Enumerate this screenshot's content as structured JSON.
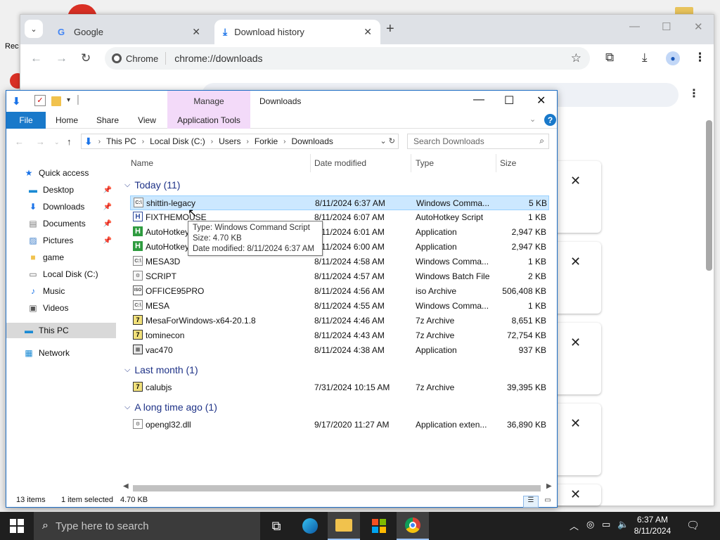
{
  "desktop": {
    "recycle_label": "Rec"
  },
  "chrome": {
    "tabs": [
      {
        "title": "Google",
        "close": "✕"
      },
      {
        "title": "Download history",
        "close": "✕"
      }
    ],
    "new_tab": "+",
    "omnibox_chip": "Chrome",
    "url": "chrome://downloads",
    "window_buttons": {
      "minimize": "—",
      "maximize": "☐",
      "close": "✕"
    },
    "download_card_close": "✕"
  },
  "explorer": {
    "title": "Downloads",
    "manage_label": "Manage",
    "ribbon_tabs": [
      "File",
      "Home",
      "Share",
      "View",
      "Application Tools"
    ],
    "breadcrumb": [
      "This PC",
      "Local Disk (C:)",
      "Users",
      "Forkie",
      "Downloads"
    ],
    "search_placeholder": "Search Downloads",
    "nav": [
      {
        "label": "Quick access",
        "icon": "star-icon"
      },
      {
        "label": "Desktop",
        "icon": "desktop-icon"
      },
      {
        "label": "Downloads",
        "icon": "downloads-icon"
      },
      {
        "label": "Documents",
        "icon": "documents-icon"
      },
      {
        "label": "Pictures",
        "icon": "pictures-icon"
      },
      {
        "label": "game",
        "icon": "folder-icon"
      },
      {
        "label": "Local Disk (C:)",
        "icon": "drive-icon"
      },
      {
        "label": "Music",
        "icon": "music-icon"
      },
      {
        "label": "Videos",
        "icon": "videos-icon"
      },
      {
        "label": "This PC",
        "icon": "pc-icon"
      },
      {
        "label": "Network",
        "icon": "network-icon"
      }
    ],
    "columns": {
      "name": "Name",
      "date": "Date modified",
      "type": "Type",
      "size": "Size"
    },
    "groups": [
      {
        "label": "Today (11)"
      },
      {
        "label": "Last month (1)"
      },
      {
        "label": "A long time ago (1)"
      }
    ],
    "files": [
      {
        "name": "shittin-legacy",
        "date": "8/11/2024 6:37 AM",
        "type": "Windows Comma...",
        "size": "5 KB",
        "icon": "cmd-file-icon"
      },
      {
        "name": "FIXTHEMOUSE",
        "date": "8/11/2024 6:07 AM",
        "type": "AutoHotkey Script",
        "size": "1 KB",
        "icon": "ahk-script-icon"
      },
      {
        "name": "AutoHotkey",
        "date": "8/11/2024 6:01 AM",
        "type": "Application",
        "size": "2,947 KB",
        "icon": "autohotkey-icon"
      },
      {
        "name": "AutoHotkey",
        "date": "8/11/2024 6:00 AM",
        "type": "Application",
        "size": "2,947 KB",
        "icon": "autohotkey-icon"
      },
      {
        "name": "MESA3D",
        "date": "8/11/2024 4:58 AM",
        "type": "Windows Comma...",
        "size": "1 KB",
        "icon": "cmd-file-icon"
      },
      {
        "name": "SCRIPT",
        "date": "8/11/2024 4:57 AM",
        "type": "Windows Batch File",
        "size": "2 KB",
        "icon": "batch-file-icon"
      },
      {
        "name": "OFFICE95PRO",
        "date": "8/11/2024 4:56 AM",
        "type": "iso Archive",
        "size": "506,408 KB",
        "icon": "iso-file-icon"
      },
      {
        "name": "MESA",
        "date": "8/11/2024 4:55 AM",
        "type": "Windows Comma...",
        "size": "1 KB",
        "icon": "cmd-file-icon"
      },
      {
        "name": "MesaForWindows-x64-20.1.8",
        "date": "8/11/2024 4:46 AM",
        "type": "7z Archive",
        "size": "8,651 KB",
        "icon": "7z-archive-icon"
      },
      {
        "name": "tominecon",
        "date": "8/11/2024 4:43 AM",
        "type": "7z Archive",
        "size": "72,754 KB",
        "icon": "7z-archive-icon"
      },
      {
        "name": "vac470",
        "date": "8/11/2024 4:38 AM",
        "type": "Application",
        "size": "937 KB",
        "icon": "application-icon"
      },
      {
        "name": "calubjs",
        "date": "7/31/2024 10:15 AM",
        "type": "7z Archive",
        "size": "39,395 KB",
        "icon": "7z-archive-icon"
      },
      {
        "name": "opengl32.dll",
        "date": "9/17/2020 11:27 AM",
        "type": "Application exten...",
        "size": "36,890 KB",
        "icon": "dll-file-icon"
      }
    ],
    "tooltip": {
      "type": "Type: Windows Command Script",
      "size": "Size: 4.70 KB",
      "modified": "Date modified: 8/11/2024 6:37 AM"
    },
    "status": {
      "count": "13 items",
      "selected": "1 item selected",
      "size": "4.70 KB"
    }
  },
  "taskbar": {
    "search_placeholder": "Type here to search",
    "time": "6:37 AM",
    "date": "8/11/2024"
  }
}
